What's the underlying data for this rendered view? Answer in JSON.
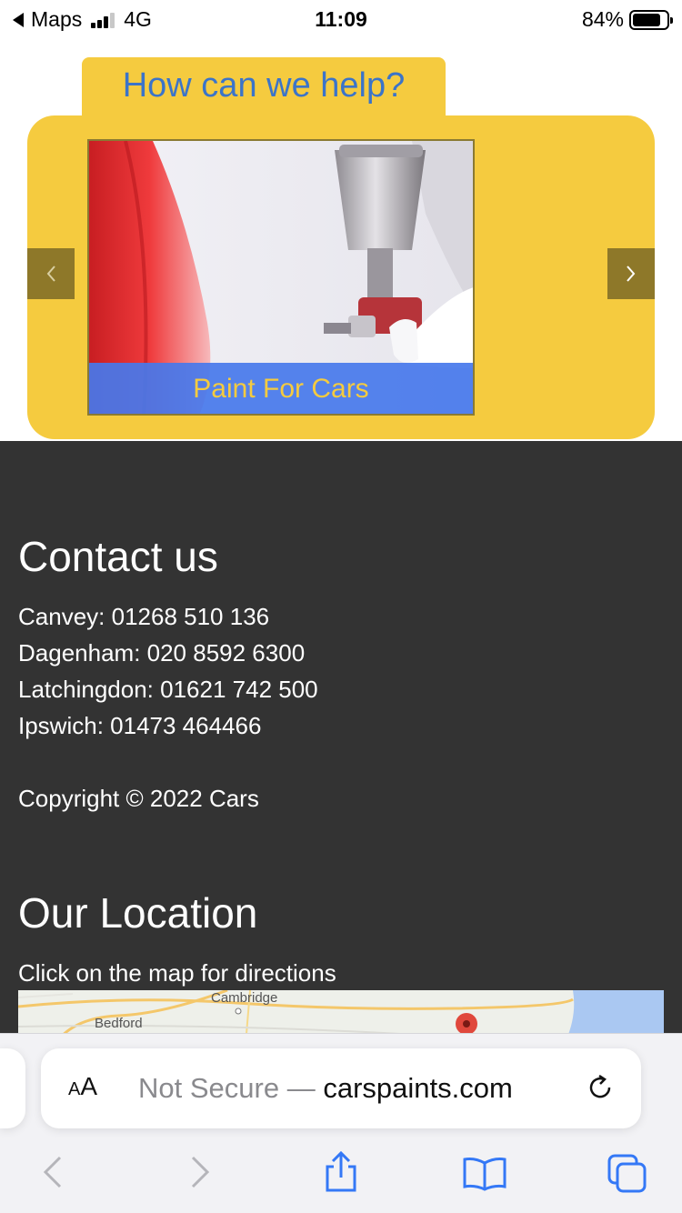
{
  "status_bar": {
    "back_app": "Maps",
    "network": "4G",
    "time": "11:09",
    "battery": "84%",
    "battery_level": 0.84
  },
  "help": {
    "title": "How can we help?",
    "slide_caption": "Paint For Cars"
  },
  "contact": {
    "heading": "Contact us",
    "lines": [
      "Canvey: 01268 510 136",
      "Dagenham: 020 8592 6300",
      "Latchingdon: 01621 742 500",
      "Ipswich: 01473 464466"
    ],
    "copyright": "Copyright © 2022 Cars"
  },
  "location": {
    "heading": "Our Location",
    "subtitle": "Click on the map for directions",
    "map_labels": [
      "Bedford",
      "Cambridge"
    ]
  },
  "browser": {
    "text_size_label_small": "A",
    "text_size_label_large": "A",
    "security": "Not Secure —",
    "domain": "carspaints.com"
  },
  "colors": {
    "accent_yellow": "#f5cb3f",
    "heading_blue": "#3b74c9",
    "footer_bg": "#333333",
    "caption_bg": "#4678eb",
    "ios_blue": "#3478f6"
  }
}
